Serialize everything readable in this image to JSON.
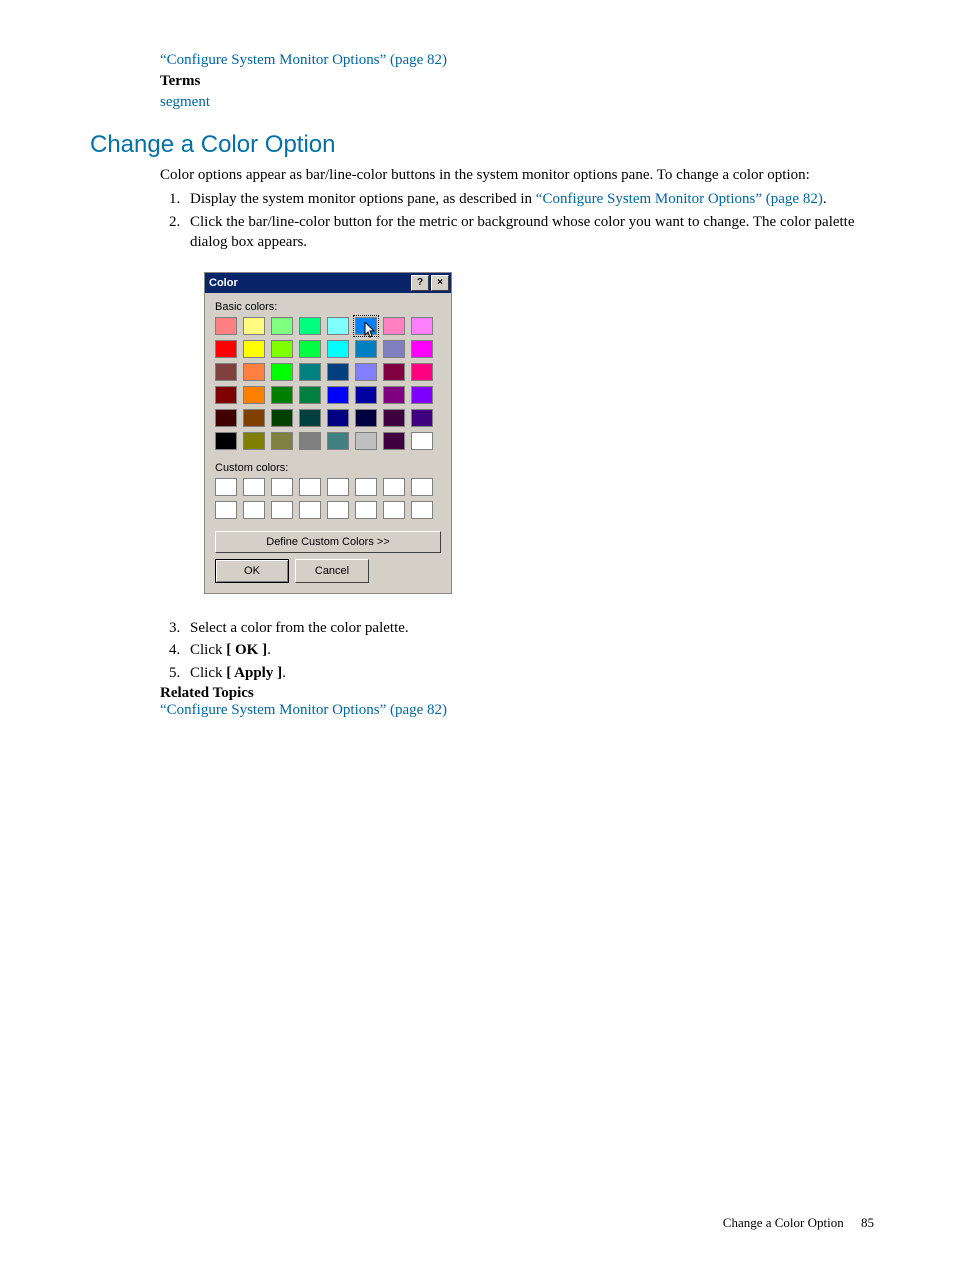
{
  "top": {
    "link1": "“Configure System Monitor Options” (page 82)",
    "terms_label": "Terms",
    "term1": "segment"
  },
  "heading": "Change a Color Option",
  "intro": "Color options appear as bar/line-color buttons in the system monitor options pane. To change a color option:",
  "steps": {
    "s1_pre": "Display the system monitor options pane, as described in ",
    "s1_link": "“Configure System Monitor Options” (page 82)",
    "s1_post": ".",
    "s2": "Click the bar/line-color button for the metric or background whose color you want to change. The color palette dialog box appears.",
    "s3": "Select a color from the color palette.",
    "s4_pre": "Click ",
    "s4_bold": "[ OK ]",
    "s4_post": ".",
    "s5_pre": "Click ",
    "s5_bold": "[ Apply ]",
    "s5_post": "."
  },
  "dialog": {
    "title": "Color",
    "help": "?",
    "close": "×",
    "basic_label": "Basic colors:",
    "basic_colors": [
      "#ff8080",
      "#fffb80",
      "#80ff80",
      "#00ff7f",
      "#80ffff",
      "#0080ff",
      "#ff80c0",
      "#ff80ff",
      "#ff0000",
      "#ffff00",
      "#80ff00",
      "#00ff40",
      "#00ffff",
      "#0080c0",
      "#8080c0",
      "#ff00ff",
      "#804040",
      "#ff8040",
      "#00ff00",
      "#008080",
      "#004080",
      "#8080ff",
      "#800040",
      "#ff0080",
      "#800000",
      "#ff8000",
      "#008000",
      "#008040",
      "#0000ff",
      "#0000a0",
      "#800080",
      "#8000ff",
      "#400000",
      "#804000",
      "#004000",
      "#004040",
      "#000080",
      "#000040",
      "#400040",
      "#400080",
      "#000000",
      "#808000",
      "#808040",
      "#808080",
      "#408080",
      "#c0c0c0",
      "#400040",
      "#ffffff"
    ],
    "selected_index": 5,
    "custom_label": "Custom colors:",
    "custom_count": 16,
    "define": "Define Custom Colors >>",
    "ok": "OK",
    "cancel": "Cancel"
  },
  "related": {
    "heading": "Related Topics",
    "link": "“Configure System Monitor Options” (page 82)"
  },
  "footer": {
    "text": "Change a Color Option",
    "page": "85"
  }
}
